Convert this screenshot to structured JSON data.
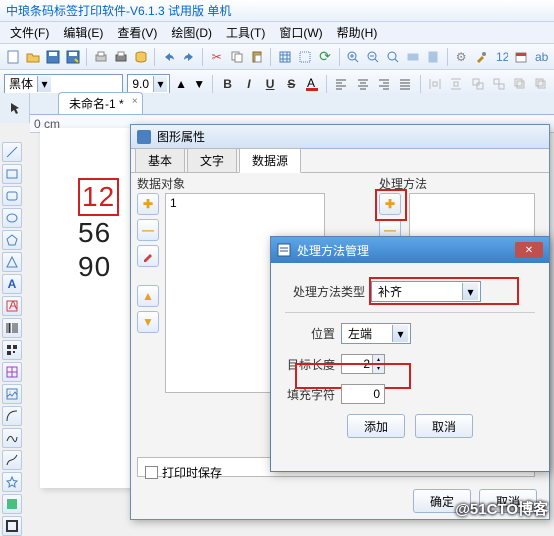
{
  "app_title": "中琅条码标签打印软件-V6.1.3 试用版 单机",
  "menu": [
    "文件(F)",
    "编辑(E)",
    "查看(V)",
    "绘图(D)",
    "工具(T)",
    "窗口(W)",
    "帮助(H)"
  ],
  "font": {
    "family": "黑体",
    "size": "9.0"
  },
  "doc_tab": "未命名-1 *",
  "ruler_zero": "0 cm",
  "canvas_numbers": {
    "n1": "12",
    "n2": "56",
    "n3": "90"
  },
  "dlg1": {
    "title": "图形属性",
    "tabs": [
      "基本",
      "文字",
      "数据源"
    ],
    "active_tab": 2,
    "data_objects_label": "数据对象",
    "proc_methods_label": "处理方法",
    "data_value": "1",
    "print_save": "打印时保存",
    "ok": "确定",
    "cancel": "取消"
  },
  "dlg2": {
    "title": "处理方法管理",
    "type_label": "处理方法类型",
    "type_value": "补齐",
    "pos_label": "位置",
    "pos_value": "左端",
    "len_label": "目标长度",
    "len_value": "2",
    "fill_label": "填充字符",
    "fill_value": "0",
    "add": "添加",
    "cancel": "取消"
  },
  "watermark": "@51CTO博客"
}
